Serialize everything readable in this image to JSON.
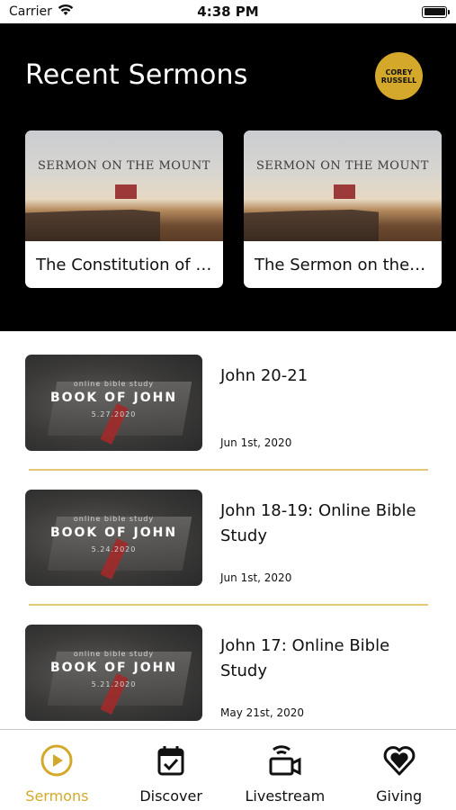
{
  "status_bar": {
    "carrier": "Carrier",
    "time": "4:38 PM"
  },
  "header": {
    "title": "Recent Sermons",
    "avatar_line1": "COREY",
    "avatar_line2": "RUSSELL"
  },
  "featured": [
    {
      "thumb_caption": "SERMON ON THE MOUNT",
      "title": "The Constitution of t…"
    },
    {
      "thumb_caption": "SERMON ON THE MOUNT",
      "title": "The Sermon on the…"
    }
  ],
  "sermons": [
    {
      "thumb_small": "online bible study",
      "thumb_big": "BOOK OF JOHN",
      "thumb_date": "5.27.2020",
      "title": "John 20-21",
      "date": "Jun 1st, 2020"
    },
    {
      "thumb_small": "online bible study",
      "thumb_big": "BOOK OF JOHN",
      "thumb_date": "5.24.2020",
      "title": "John 18-19: Online Bible Study",
      "date": "Jun 1st, 2020"
    },
    {
      "thumb_small": "online bible study",
      "thumb_big": "BOOK OF JOHN",
      "thumb_date": "5.21.2020",
      "title": "John 17: Online Bible Study",
      "date": "May 21st, 2020"
    }
  ],
  "tabs": [
    {
      "label": "Sermons",
      "icon": "play-circle-icon",
      "active": true
    },
    {
      "label": "Discover",
      "icon": "calendar-check-icon",
      "active": false
    },
    {
      "label": "Livestream",
      "icon": "video-camera-icon",
      "active": false
    },
    {
      "label": "Giving",
      "icon": "heart-icon",
      "active": false
    }
  ],
  "colors": {
    "accent": "#d4a82a",
    "hero_bg": "#000000",
    "divider": "#e6c773"
  }
}
